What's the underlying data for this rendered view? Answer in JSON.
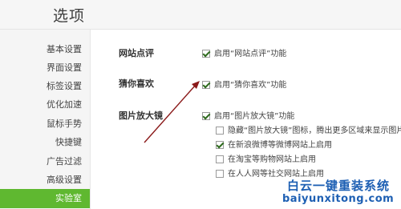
{
  "header": {
    "title": "选项"
  },
  "sidebar": {
    "items": [
      {
        "label": "基本设置"
      },
      {
        "label": "界面设置"
      },
      {
        "label": "标签设置"
      },
      {
        "label": "优化加速"
      },
      {
        "label": "鼠标手势"
      },
      {
        "label": "快捷键"
      },
      {
        "label": "广告过滤"
      },
      {
        "label": "高级设置"
      },
      {
        "label": "实验室"
      }
    ],
    "active": "实验室"
  },
  "sections": {
    "site_review": {
      "title": "网站点评",
      "option": {
        "label": "启用“网站点评”功能",
        "checked": true
      }
    },
    "guess_you_like": {
      "title": "猜你喜欢",
      "option": {
        "label": "启用“猜你喜欢”功能",
        "checked": true
      }
    },
    "image_magnifier": {
      "title": "图片放大镜",
      "option": {
        "label": "启用“图片放大镜”功能",
        "checked": true
      },
      "sub_options": [
        {
          "label": "隐藏“图片放大镜”图标，腾出更多区域来显示图片",
          "checked": false
        },
        {
          "label": "在新浪微博等微博网站上启用",
          "checked": true
        },
        {
          "label": "在淘宝等购物网站上启用",
          "checked": false
        },
        {
          "label": "在人人网等社交网站上启用",
          "checked": false
        }
      ]
    }
  },
  "watermark": {
    "name": "白云一键重装系统",
    "url": "baiyunxitong.com"
  },
  "colors": {
    "active_nav": "#5fb830",
    "annotation_arrow": "#8b1a1a",
    "watermark": "#1d5fb3"
  }
}
